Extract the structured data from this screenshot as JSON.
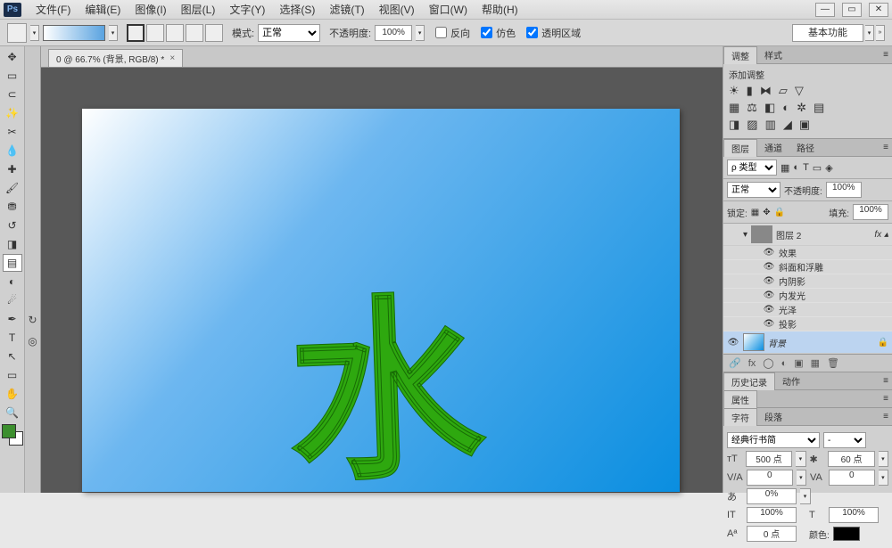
{
  "titlebar": {
    "logo": "Ps"
  },
  "menu": [
    "文件(F)",
    "编辑(E)",
    "图像(I)",
    "图层(L)",
    "文字(Y)",
    "选择(S)",
    "滤镜(T)",
    "视图(V)",
    "窗口(W)",
    "帮助(H)"
  ],
  "options": {
    "mode_label": "模式:",
    "mode_value": "正常",
    "opacity_label": "不透明度:",
    "opacity_value": "100%",
    "reverse": "反向",
    "dither": "仿色",
    "transp": "透明区域",
    "workspace": "基本功能"
  },
  "tab": {
    "title": "0 @ 66.7% (背景, RGB/8) *"
  },
  "canvas_char": "水",
  "adjust_panel": {
    "tab1": "调整",
    "tab2": "样式",
    "title": "添加调整"
  },
  "layers_panel": {
    "tabs": [
      "图层",
      "通道",
      "路径"
    ],
    "kind": "ρ 类型",
    "blend": "正常",
    "opacity_label": "不透明度:",
    "opacity": "100%",
    "lock_label": "锁定:",
    "fill_label": "填充:",
    "fill": "100%",
    "layer2": "图层 2",
    "effects": "效果",
    "fx": [
      "斜面和浮雕",
      "内阴影",
      "内发光",
      "光泽",
      "投影"
    ],
    "bg_layer": "背景"
  },
  "history_panel": {
    "tabs": [
      "历史记录",
      "动作"
    ]
  },
  "props_panel": {
    "tab": "属性"
  },
  "char_panel": {
    "tabs": [
      "字符",
      "段落"
    ],
    "font": "经典行书简",
    "size": "500 点",
    "leading": "60 点",
    "tracking": "0",
    "va2": "0",
    "height": "0%",
    "wscale": "100%",
    "hscale": "100%",
    "baseline": "0 点",
    "color_label": "颜色:"
  }
}
